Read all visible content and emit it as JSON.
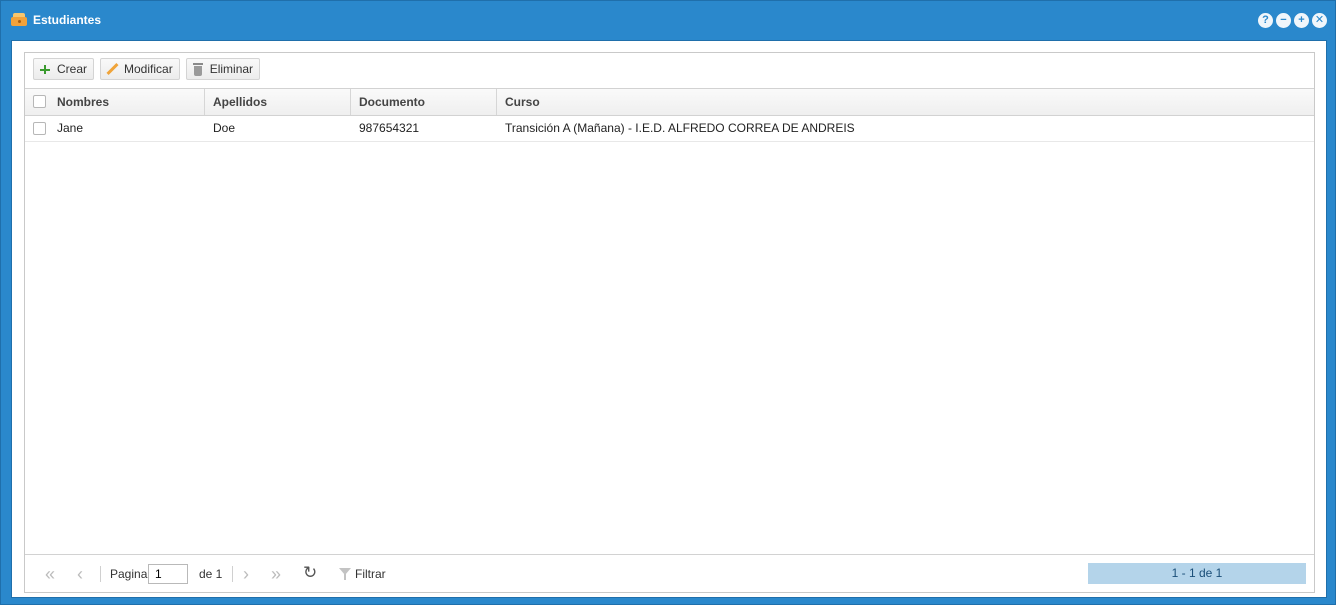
{
  "window": {
    "title": "Estudiantes",
    "title_icon": "briefcase-icon",
    "tools": [
      "help-icon",
      "minimize-icon",
      "maximize-icon",
      "close-icon"
    ],
    "tool_glyphs": [
      "?",
      "−",
      "+",
      "✕"
    ],
    "accent_color": "#2a88cc"
  },
  "toolbar": {
    "create_label": "Crear",
    "edit_label": "Modificar",
    "delete_label": "Eliminar"
  },
  "grid": {
    "columns": [
      "Nombres",
      "Apellidos",
      "Documento",
      "Curso"
    ],
    "rows": [
      {
        "nombres": "Jane",
        "apellidos": "Doe",
        "documento": "987654321",
        "curso": "Transición A (Mañana) - I.E.D. ALFREDO CORREA DE ANDREIS"
      }
    ]
  },
  "pager": {
    "page_label": "Pagina",
    "page_value": "1",
    "of_label": "de 1",
    "filter_label": "Filtrar",
    "info": "1 - 1 de 1"
  }
}
